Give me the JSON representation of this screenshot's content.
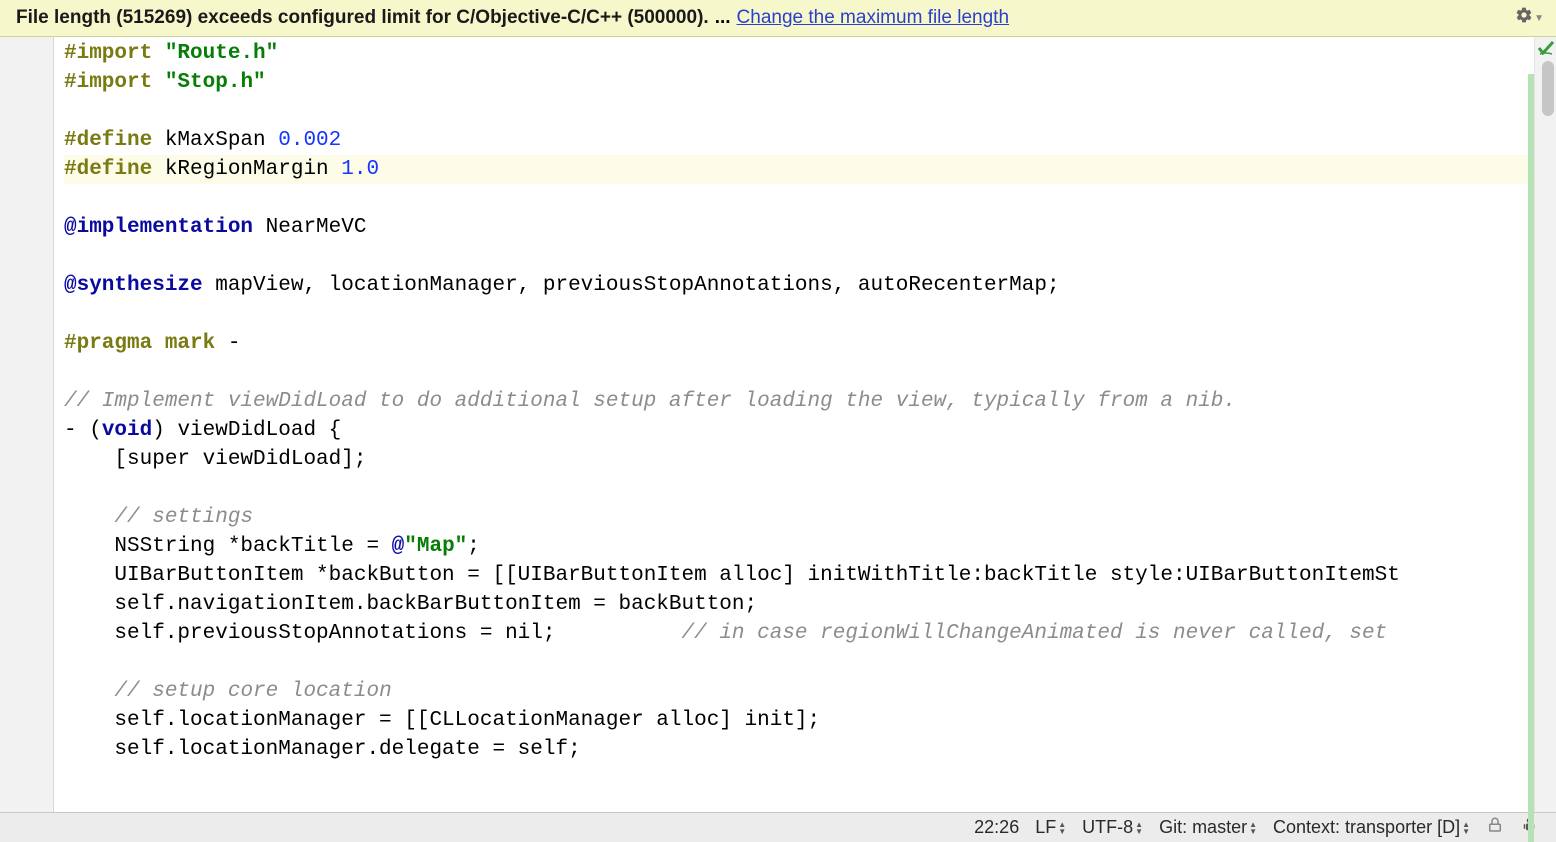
{
  "notification": {
    "message": "File length (515269) exceeds configured limit for C/Objective-C/C++ (500000).",
    "ellipsis": "...",
    "linkText": "Change the maximum file length",
    "gearIcon": "gear-icon"
  },
  "code": {
    "lines": [
      {
        "hl": false,
        "segments": [
          {
            "c": "pp",
            "t": "#import"
          },
          {
            "c": "id",
            "t": " "
          },
          {
            "c": "str",
            "t": "\"Route.h\""
          }
        ]
      },
      {
        "hl": false,
        "segments": [
          {
            "c": "pp",
            "t": "#import"
          },
          {
            "c": "id",
            "t": " "
          },
          {
            "c": "str",
            "t": "\"Stop.h\""
          }
        ]
      },
      {
        "hl": false,
        "segments": []
      },
      {
        "hl": false,
        "segments": [
          {
            "c": "pp",
            "t": "#define"
          },
          {
            "c": "id",
            "t": " kMaxSpan "
          },
          {
            "c": "num",
            "t": "0.002"
          }
        ]
      },
      {
        "hl": true,
        "segments": [
          {
            "c": "pp",
            "t": "#define"
          },
          {
            "c": "id",
            "t": " kRegionMargin "
          },
          {
            "c": "num",
            "t": "1.0"
          }
        ]
      },
      {
        "hl": false,
        "segments": []
      },
      {
        "hl": false,
        "segments": [
          {
            "c": "kw",
            "t": "@implementation"
          },
          {
            "c": "id",
            "t": " NearMeVC"
          }
        ]
      },
      {
        "hl": false,
        "segments": []
      },
      {
        "hl": false,
        "segments": [
          {
            "c": "kw",
            "t": "@synthesize"
          },
          {
            "c": "id",
            "t": " mapView, locationManager, previousStopAnnotations, autoRecenterMap;"
          }
        ]
      },
      {
        "hl": false,
        "segments": []
      },
      {
        "hl": false,
        "segments": [
          {
            "c": "pp",
            "t": "#pragma mark"
          },
          {
            "c": "id",
            "t": " -"
          }
        ]
      },
      {
        "hl": false,
        "segments": []
      },
      {
        "hl": false,
        "segments": [
          {
            "c": "cm",
            "t": "// Implement viewDidLoad to do additional setup after loading the view, typically from a nib."
          }
        ]
      },
      {
        "hl": false,
        "segments": [
          {
            "c": "id",
            "t": "- ("
          },
          {
            "c": "kw",
            "t": "void"
          },
          {
            "c": "id",
            "t": ") viewDidLoad {"
          }
        ]
      },
      {
        "hl": false,
        "segments": [
          {
            "c": "id",
            "t": "    [super viewDidLoad];"
          }
        ]
      },
      {
        "hl": false,
        "segments": []
      },
      {
        "hl": false,
        "segments": [
          {
            "c": "id",
            "t": "    "
          },
          {
            "c": "cm",
            "t": "// settings"
          }
        ]
      },
      {
        "hl": false,
        "segments": [
          {
            "c": "id",
            "t": "    NSString *backTitle = "
          },
          {
            "c": "kw",
            "t": "@"
          },
          {
            "c": "str",
            "t": "\"Map\""
          },
          {
            "c": "id",
            "t": ";"
          }
        ]
      },
      {
        "hl": false,
        "segments": [
          {
            "c": "id",
            "t": "    UIBarButtonItem *backButton = [[UIBarButtonItem alloc] initWithTitle:backTitle style:UIBarButtonItemSt"
          }
        ]
      },
      {
        "hl": false,
        "segments": [
          {
            "c": "id",
            "t": "    self.navigationItem.backBarButtonItem = backButton;"
          }
        ]
      },
      {
        "hl": false,
        "segments": [
          {
            "c": "id",
            "t": "    self.previousStopAnnotations = nil;          "
          },
          {
            "c": "cm",
            "t": "// in case regionWillChangeAnimated is never called, set"
          }
        ]
      },
      {
        "hl": false,
        "segments": []
      },
      {
        "hl": false,
        "segments": [
          {
            "c": "id",
            "t": "    "
          },
          {
            "c": "cm",
            "t": "// setup core location"
          }
        ]
      },
      {
        "hl": false,
        "segments": [
          {
            "c": "id",
            "t": "    self.locationManager = [[CLLocationManager alloc] init];"
          }
        ]
      },
      {
        "hl": false,
        "segments": [
          {
            "c": "id",
            "t": "    self.locationManager.delegate = self;"
          }
        ]
      }
    ]
  },
  "statusBar": {
    "cursor": "22:26",
    "lineEnding": "LF",
    "encoding": "UTF-8",
    "gitLabel": "Git: master",
    "contextLabel": "Context: transporter [D]"
  }
}
